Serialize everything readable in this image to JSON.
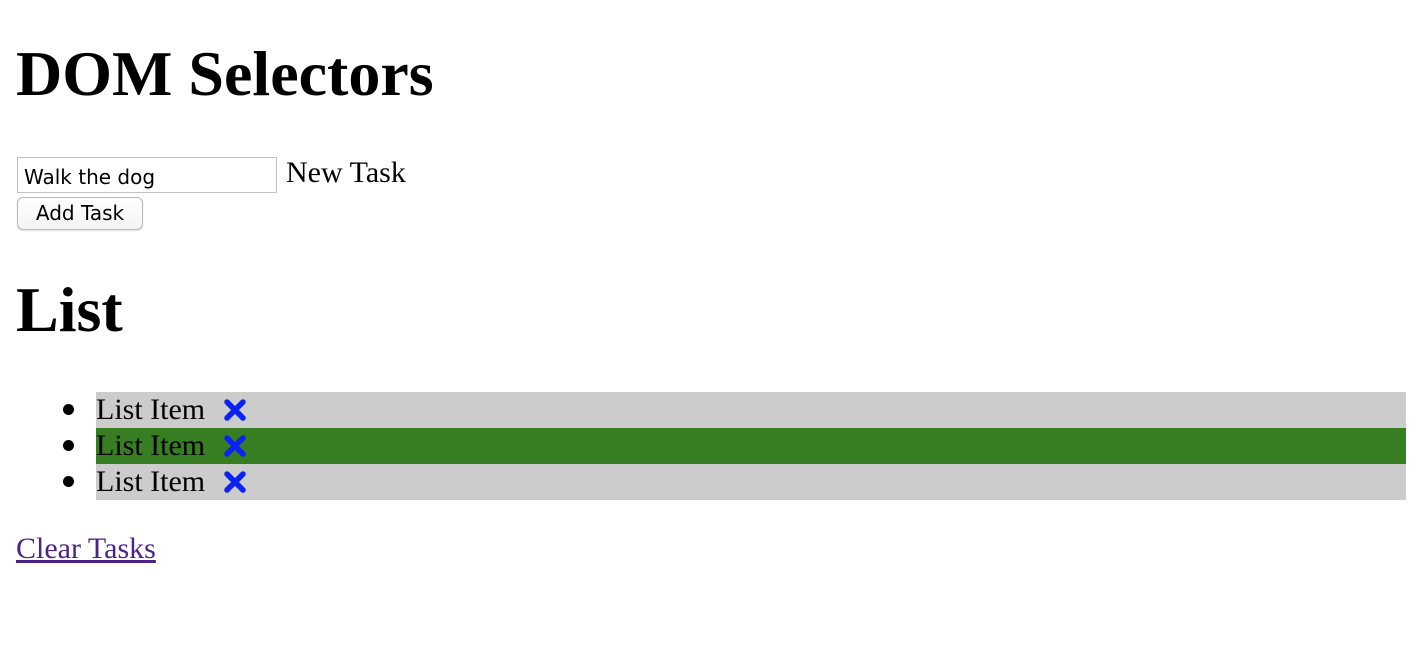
{
  "header": {
    "title": "DOM Selectors"
  },
  "form": {
    "input_value": "Walk the dog",
    "input_label": "New Task",
    "add_button_label": "Add Task"
  },
  "list": {
    "title": "List",
    "items": [
      {
        "label": "List Item",
        "highlighted": false,
        "delete_icon": "heavy-x-icon"
      },
      {
        "label": "List Item",
        "highlighted": true,
        "delete_icon": "heavy-x-icon"
      },
      {
        "label": "List Item",
        "highlighted": false,
        "delete_icon": "heavy-x-icon"
      }
    ],
    "colors": {
      "item_background": "#cccccc",
      "highlight_background": "#377d22",
      "delete_icon": "#0a22f5"
    }
  },
  "footer": {
    "clear_link_label": "Clear Tasks",
    "link_color": "#4b2288"
  }
}
